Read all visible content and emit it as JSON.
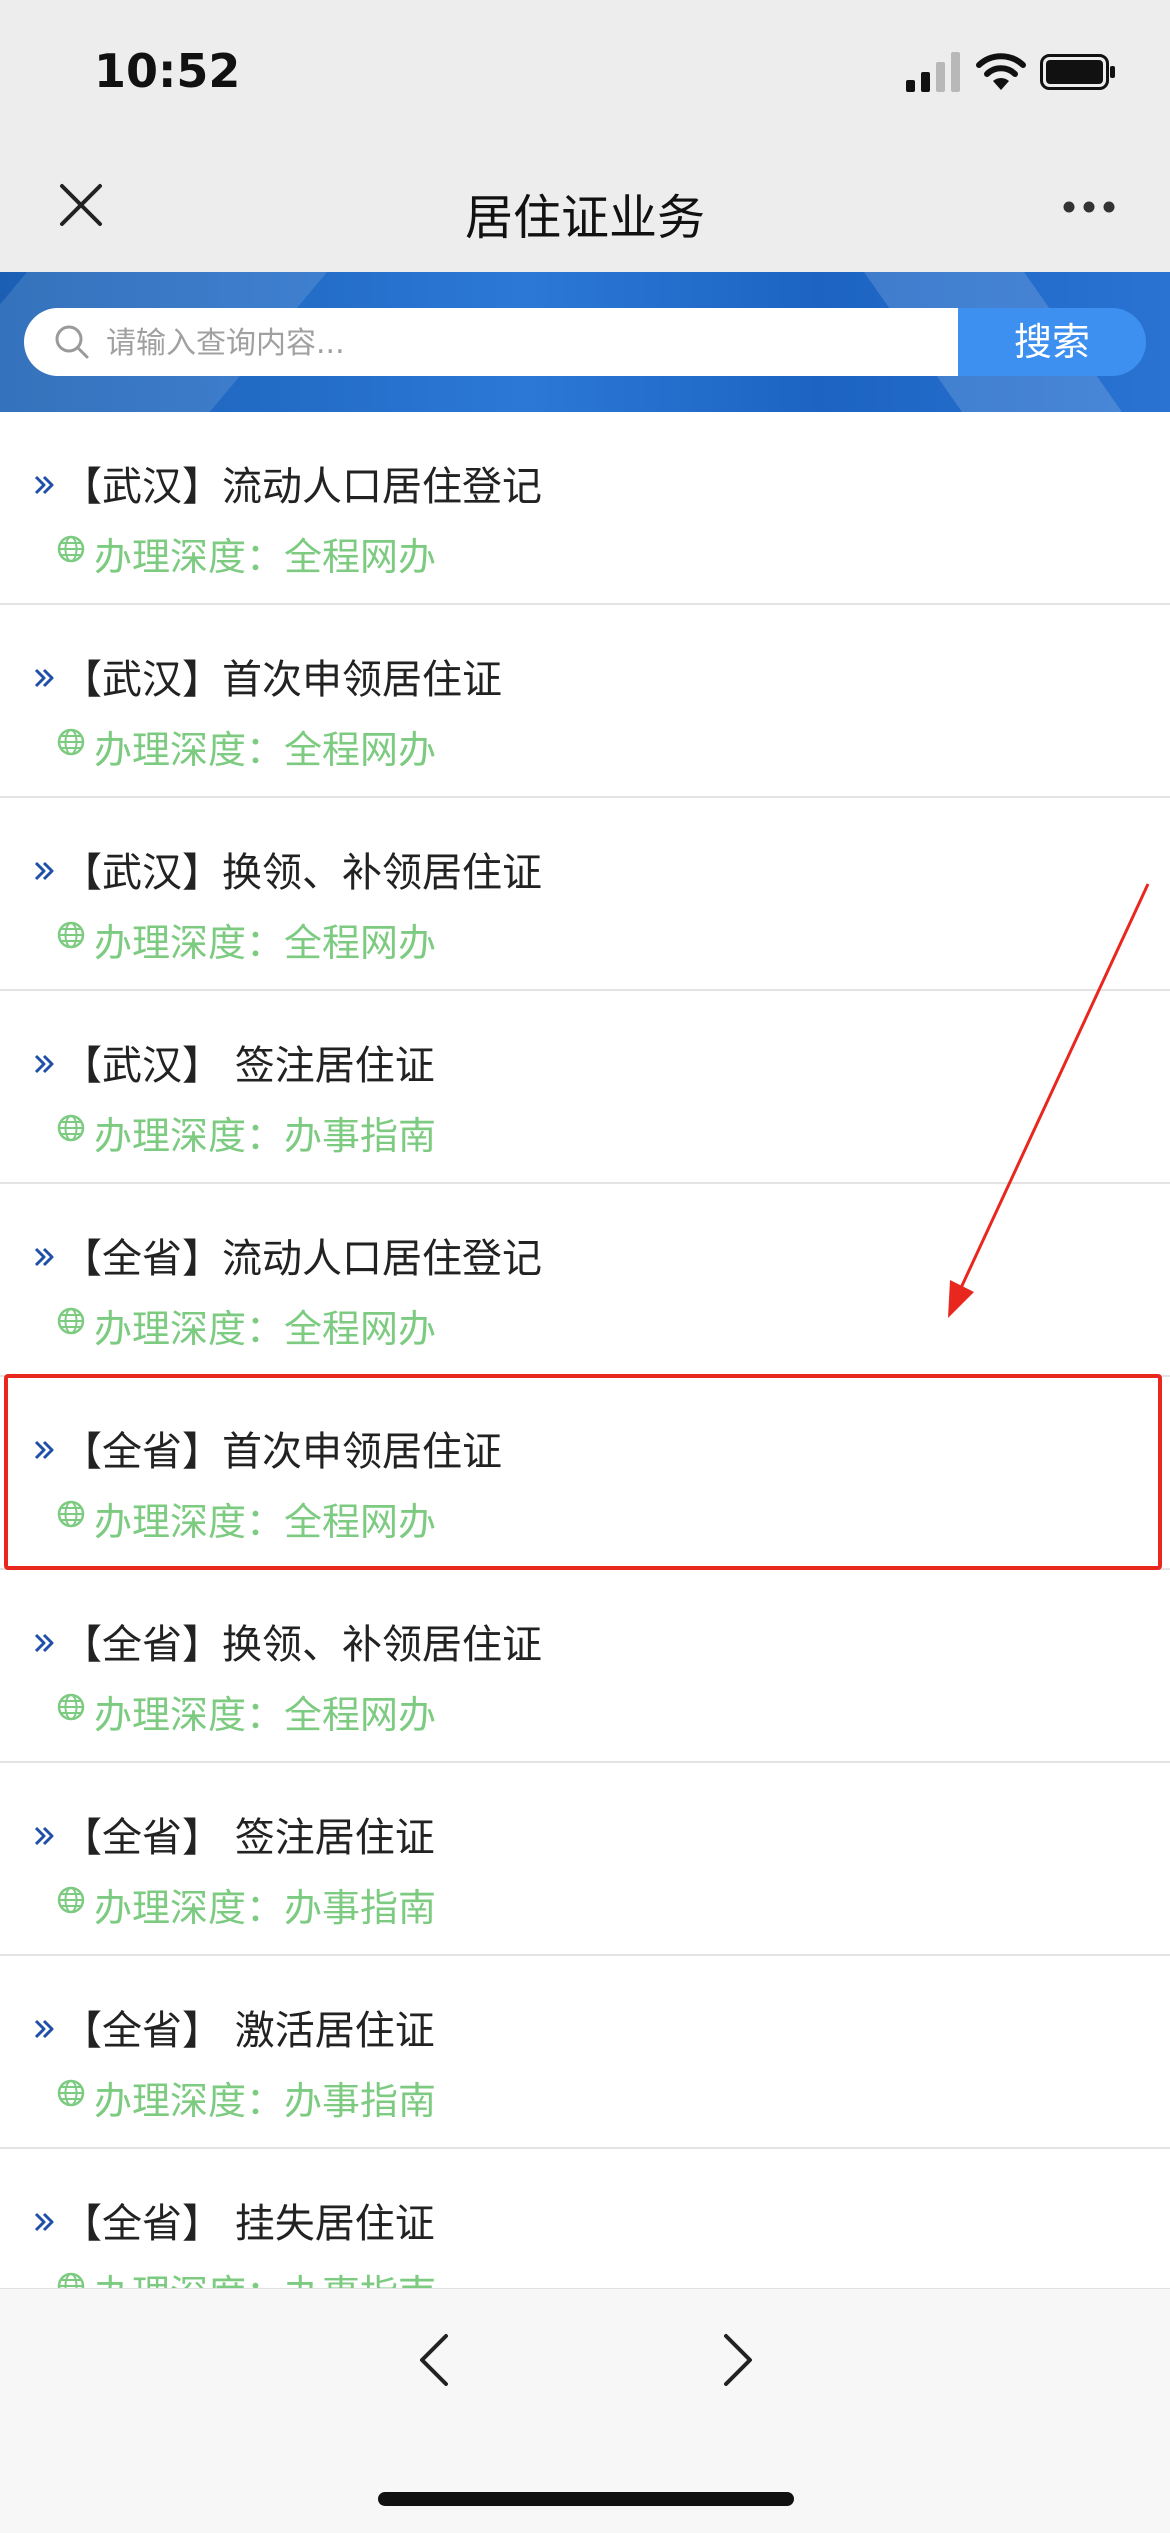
{
  "status_bar": {
    "time": "10:52"
  },
  "nav": {
    "title": "居住证业务"
  },
  "search": {
    "placeholder": "请输入查询内容...",
    "button_label": "搜索"
  },
  "items": [
    {
      "title": "【武汉】流动人口居住登记",
      "depth": "办理深度：全程网办"
    },
    {
      "title": "【武汉】首次申领居住证",
      "depth": "办理深度：全程网办"
    },
    {
      "title": "【武汉】换领、补领居住证",
      "depth": "办理深度：全程网办"
    },
    {
      "title": "【武汉】 签注居住证",
      "depth": "办理深度：办事指南"
    },
    {
      "title": "【全省】流动人口居住登记",
      "depth": "办理深度：全程网办"
    },
    {
      "title": "【全省】首次申领居住证",
      "depth": "办理深度：全程网办"
    },
    {
      "title": "【全省】换领、补领居住证",
      "depth": "办理深度：全程网办"
    },
    {
      "title": "【全省】 签注居住证",
      "depth": "办理深度：办事指南"
    },
    {
      "title": "【全省】 激活居住证",
      "depth": "办理深度：办事指南"
    },
    {
      "title": "【全省】 挂失居住证",
      "depth": "办理深度：办事指南"
    }
  ],
  "colors": {
    "accent": "#3d8ff0",
    "depth_text": "#7ccb80",
    "highlight": "#e8271f"
  },
  "icons": {
    "close": "close-icon",
    "more": "more-icon",
    "search": "search-icon",
    "arrow": "double-chevron-icon",
    "globe": "globe-icon",
    "back": "chevron-left-icon",
    "forward": "chevron-right-icon"
  }
}
